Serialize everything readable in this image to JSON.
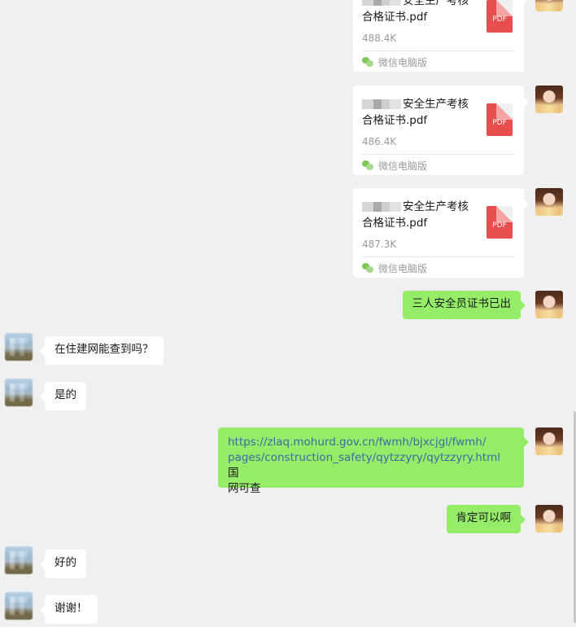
{
  "messages": {
    "files": [
      {
        "name": "安全生产考核合格证书.pdf",
        "name_line1": "安全生产考核",
        "name_line2": "合格证书.pdf",
        "size": "488.4K",
        "source": "微信电脑版",
        "icon": "pdf-icon",
        "icon_label": "PDF"
      },
      {
        "name": "安全生产考核合格证书.pdf",
        "name_line1": "安全生产考核",
        "name_line2": "合格证书.pdf",
        "size": "486.4K",
        "source": "微信电脑版",
        "icon": "pdf-icon",
        "icon_label": "PDF"
      },
      {
        "name": "安全生产考核合格证书.pdf",
        "name_line1": "安全生产考核",
        "name_line2": "合格证书.pdf",
        "size": "487.3K",
        "source": "微信电脑版",
        "icon": "pdf-icon",
        "icon_label": "PDF"
      }
    ],
    "sent_1": "三人安全员证书已出",
    "recv_1": "在住建网能查到吗？",
    "recv_2": "是的",
    "sent_link_url_line1": "https://zlaq.mohurd.gov.cn/fwmh/bjxcjgl/fwmh/",
    "sent_link_url_line2": "pages/construction_safety/qytzzyry/qytzzyry.html",
    "sent_link_suffix_a": " 国",
    "sent_link_suffix_b": "网可查",
    "sent_2": "肯定可以啊",
    "recv_3": "好的",
    "recv_4": "谢谢！"
  },
  "colors": {
    "background": "#f0f0f0",
    "sent_bubble": "#95ec69",
    "received_bubble": "#ffffff",
    "link": "#3d6aa3",
    "pdf_red": "#e84e4e"
  }
}
